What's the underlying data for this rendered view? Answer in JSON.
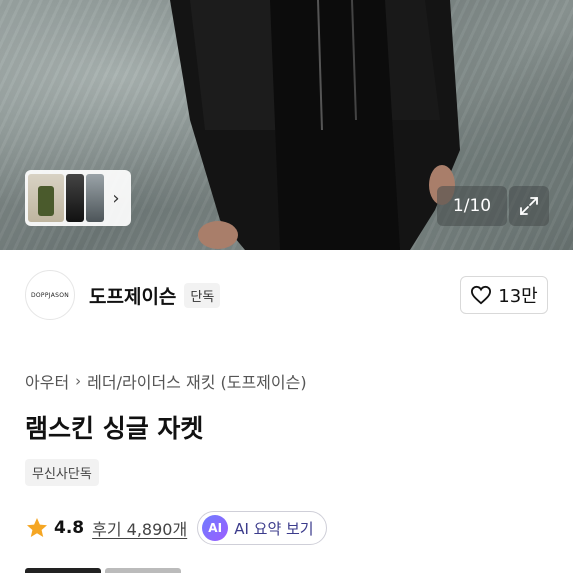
{
  "gallery": {
    "pager_text": "1/10"
  },
  "brand": {
    "logo_text": "DOPPJASON",
    "name": "도프제이슨",
    "badge": "단독"
  },
  "like": {
    "count": "13만"
  },
  "breadcrumb": {
    "items": [
      "아우터",
      "레더/라이더스 재킷 (도프제이슨)"
    ]
  },
  "product": {
    "title": "램스킨 싱글 자켓",
    "tag": "무신사단독"
  },
  "rating": {
    "score": "4.8",
    "reviews": "후기 4,890개",
    "ai_badge": "AI",
    "ai_label": "AI 요약 보기"
  },
  "colors": {
    "star": "#f5a623",
    "ai_gradient_start": "#6f7dff",
    "ai_gradient_end": "#9b5cff"
  },
  "icons": {
    "heart": "heart-icon",
    "expand": "expand-icon",
    "chevron": "chevron-right-icon",
    "star": "star-icon"
  }
}
